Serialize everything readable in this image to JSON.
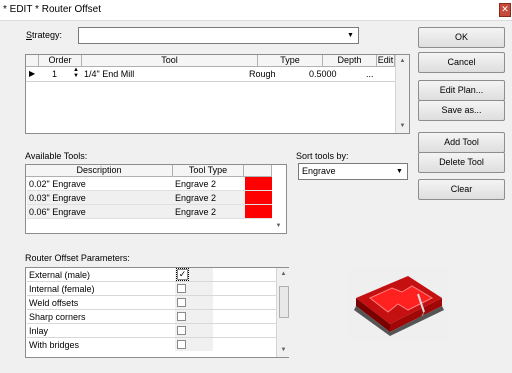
{
  "window": {
    "title": "* EDIT * Router Offset"
  },
  "strategy": {
    "label": "Strategy:",
    "value": ""
  },
  "tool_table": {
    "columns": [
      "Order",
      "Tool",
      "Type",
      "Depth",
      "Edit"
    ],
    "rows": [
      {
        "order": "1",
        "tool": "1/4\" End Mill",
        "type": "Rough",
        "depth": "0.5000",
        "edit": "..."
      }
    ]
  },
  "available_tools": {
    "label": "Available Tools:",
    "columns": [
      "Description",
      "Tool Type",
      ""
    ],
    "rows": [
      {
        "description": "0.02\" Engrave",
        "tool_type": "Engrave 2",
        "color": "#ff0000"
      },
      {
        "description": "0.03\" Engrave",
        "tool_type": "Engrave 2",
        "color": "#ff0000"
      },
      {
        "description": "0.06\" Engrave",
        "tool_type": "Engrave 2",
        "color": "#ff0000"
      }
    ]
  },
  "sort": {
    "label": "Sort tools by:",
    "value": "Engrave"
  },
  "parameters": {
    "label": "Router Offset Parameters:",
    "rows": [
      {
        "label": "External (male)",
        "checked": true
      },
      {
        "label": "Internal (female)",
        "checked": false
      },
      {
        "label": "Weld offsets",
        "checked": false
      },
      {
        "label": "Sharp corners",
        "checked": false
      },
      {
        "label": "Inlay",
        "checked": false
      },
      {
        "label": "With bridges",
        "checked": false
      }
    ]
  },
  "buttons": {
    "ok": "OK",
    "cancel": "Cancel",
    "edit_plan": "Edit Plan...",
    "save_as": "Save as...",
    "add_tool": "Add Tool",
    "delete_tool": "Delete Tool",
    "clear": "Clear"
  },
  "colors": {
    "tool_swatch": "#ff0000",
    "preview_red": "#e01010"
  },
  "icons": {
    "row_pointer": "triangle-right-icon",
    "spinner": "spinner-icon",
    "preview": "router-offset-preview-image"
  }
}
